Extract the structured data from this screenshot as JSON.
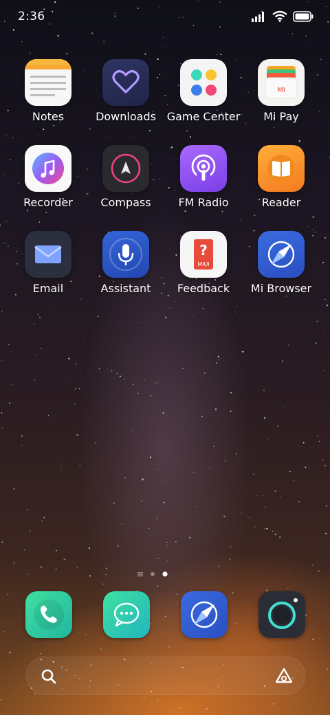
{
  "status_bar": {
    "time": "2:36"
  },
  "apps": [
    {
      "label": "Notes"
    },
    {
      "label": "Downloads"
    },
    {
      "label": "Game Center"
    },
    {
      "label": "Mi Pay"
    },
    {
      "label": "Recorder"
    },
    {
      "label": "Compass"
    },
    {
      "label": "FM Radio"
    },
    {
      "label": "Reader"
    },
    {
      "label": "Email"
    },
    {
      "label": "Assistant"
    },
    {
      "label": "Feedback"
    },
    {
      "label": "Mi Browser"
    }
  ],
  "mi_pay_logo": "MI",
  "feedback_badge": "MIUI",
  "pages": {
    "count": 3,
    "current": 3
  },
  "icons": {
    "notes": "notes-icon",
    "downloads": "heart-icon",
    "game_center": "game-dots-icon",
    "mi_pay": "wallet-icon",
    "recorder": "music-note-icon",
    "compass": "compass-arrow-icon",
    "fm_radio": "podcast-icon",
    "reader": "book-icon",
    "email": "envelope-icon",
    "assistant": "microphone-icon",
    "feedback": "question-icon",
    "mi_browser": "browser-compass-icon",
    "dock": [
      "phone-icon",
      "messages-icon",
      "browser-icon",
      "camera-icon"
    ],
    "search": "search-icon",
    "assistant_shortcut": "triangle-shortcut-icon"
  }
}
